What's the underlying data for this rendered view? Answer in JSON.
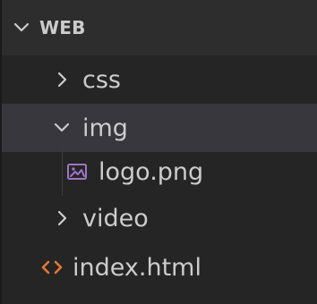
{
  "explorer": {
    "header": {
      "title": "WEB",
      "expanded": true,
      "chevron_icon": "chevron-down-icon"
    },
    "tree": [
      {
        "type": "folder",
        "label": "css",
        "expanded": false,
        "chevron_icon": "chevron-right-icon"
      },
      {
        "type": "folder",
        "label": "img",
        "expanded": true,
        "selected": true,
        "chevron_icon": "chevron-down-icon",
        "children": [
          {
            "type": "file",
            "label": "logo.png",
            "icon": "image-file-icon",
            "icon_color": "#a074c4"
          }
        ]
      },
      {
        "type": "folder",
        "label": "video",
        "expanded": false,
        "chevron_icon": "chevron-right-icon"
      },
      {
        "type": "file",
        "label": "index.html",
        "icon": "html-file-icon",
        "icon_color": "#e37933"
      }
    ]
  },
  "theme": {
    "background": "#252526",
    "header_background": "#2d2d2d",
    "selected_row_background": "#37373d",
    "text": "#cccccc"
  }
}
